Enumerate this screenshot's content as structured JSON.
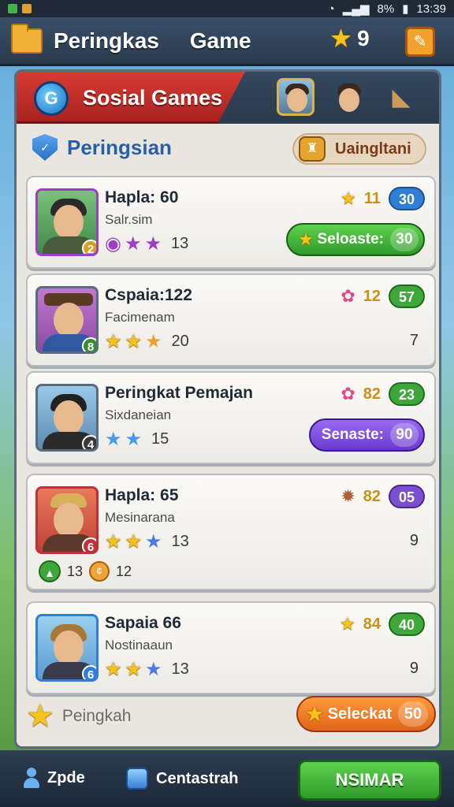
{
  "status_bar": {
    "battery": "8%",
    "time": "13:39"
  },
  "header": {
    "title": "Peringkas     Game",
    "star_count": "9"
  },
  "tabs": {
    "active_label": "Sosial Games"
  },
  "section": {
    "title": "Peringsian",
    "sort_label": "Uaingltani"
  },
  "players": [
    {
      "name": "Hapla: 60",
      "sub": "Salr.sim",
      "level": "2",
      "stars_count": "13",
      "points": "11",
      "badge": "30",
      "action_label": "Seloaste:",
      "action_value": "30",
      "frame_color": "#9b3fc7",
      "badge_color": "#2f7ed8"
    },
    {
      "name": "Cspaia:122",
      "sub": "Facimenam",
      "level": "8",
      "stars_count": "20",
      "points": "12",
      "badge": "57",
      "right_num": "7",
      "frame_color": "#5a6b7d",
      "badge_color": "#3ea63a"
    },
    {
      "name": "Peringkat Pemajan",
      "sub": "Sixdaneian",
      "level": "4",
      "stars_count": "15",
      "points": "82",
      "badge": "23",
      "action_label": "Senaste:",
      "action_value": "90",
      "frame_color": "#5a6b7d",
      "badge_color": "#3ea63a"
    },
    {
      "name": "Hapla: 65",
      "sub": "Mesinarana",
      "level": "6",
      "stars_count": "13",
      "points": "82",
      "badge": "05",
      "right_num": "9",
      "extra_a": "13",
      "extra_b": "12",
      "frame_color": "#c0303a",
      "badge_color": "#7a4fd0"
    },
    {
      "name": "Sapaia 66",
      "sub": "Nostinaaun",
      "level": "6",
      "stars_count": "13",
      "points": "84",
      "badge": "40",
      "right_num": "9",
      "frame_color": "#2f7ed8",
      "badge_color": "#3ea63a"
    }
  ],
  "footer": {
    "label": "Peingkah",
    "button_label": "Seleckat",
    "button_value": "50"
  },
  "bottom_bar": {
    "item1": "Zpde",
    "item2": "Centastrah",
    "main_button": "NSIMAR"
  }
}
